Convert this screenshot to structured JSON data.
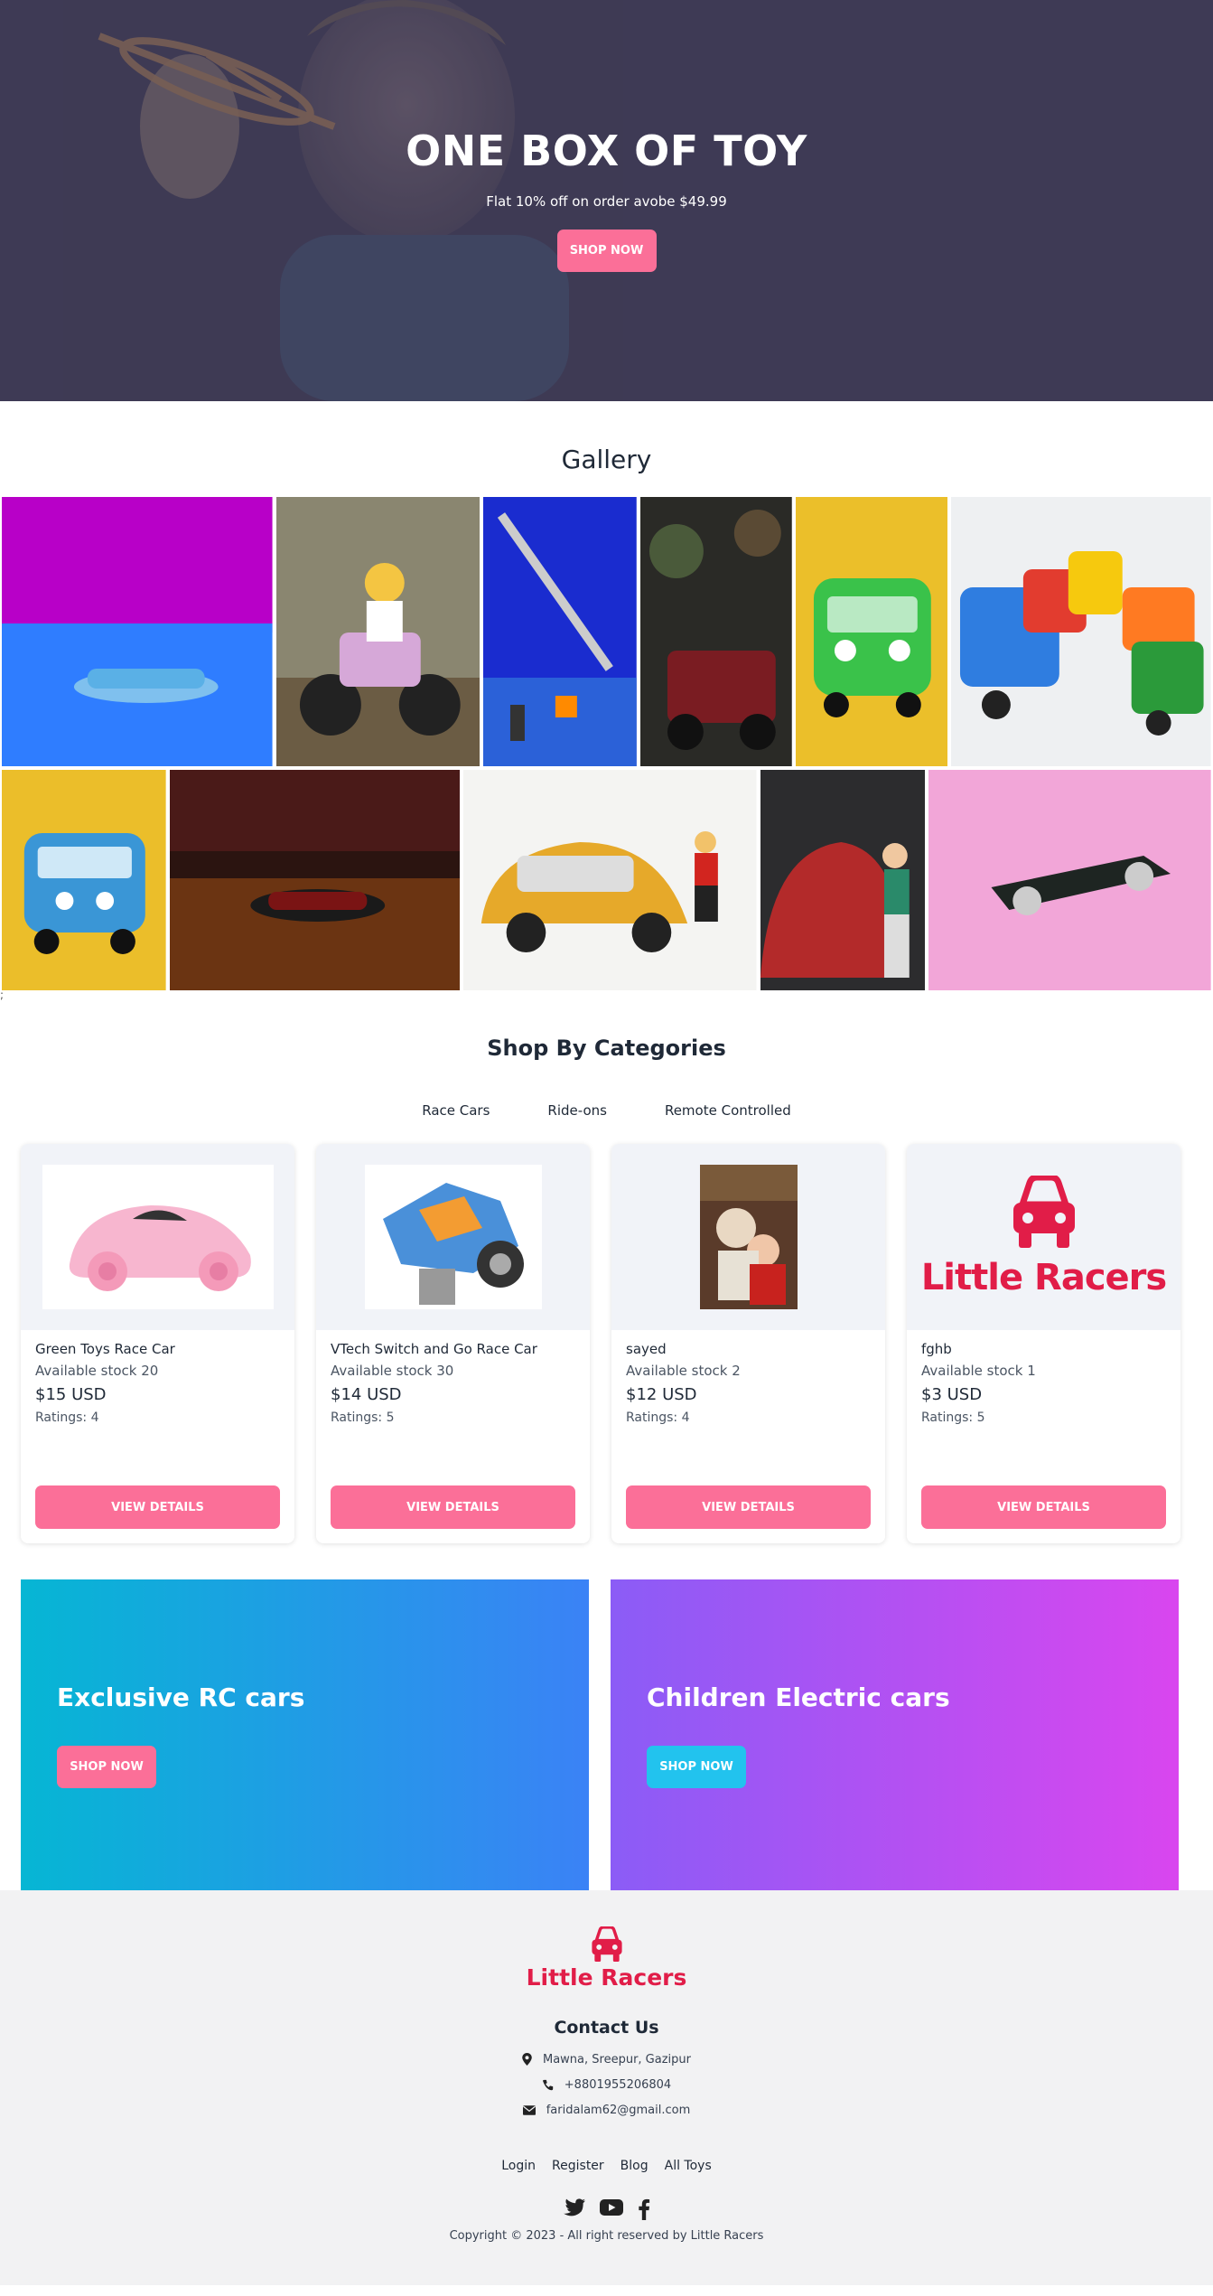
{
  "hero": {
    "title": "ONE BOX OF TOY",
    "subtitle": "Flat 10% off on order avobe $49.99",
    "button": "SHOP NOW"
  },
  "gallery": {
    "title": "Gallery",
    "row1": [
      {
        "label": "blue convertible toy car"
      },
      {
        "label": "lego figure on quad bike"
      },
      {
        "label": "lego crane"
      },
      {
        "label": "red toy truck"
      },
      {
        "label": "green toy bus"
      },
      {
        "label": "toy trucks group"
      }
    ],
    "row2": [
      {
        "label": "blue toy bus"
      },
      {
        "label": "black race car"
      },
      {
        "label": "yellow fiat with lego figure"
      },
      {
        "label": "red beetle with figure"
      },
      {
        "label": "black roadster"
      }
    ],
    "stray": ";"
  },
  "categories": {
    "title": "Shop By Categories",
    "tabs": [
      "Race Cars",
      "Ride-ons",
      "Remote Controlled"
    ],
    "cards": [
      {
        "name": "Green Toys Race Car",
        "stock": "Available stock 20",
        "price": "$15 USD",
        "rating": "Ratings: 4",
        "button": "VIEW DETAILS"
      },
      {
        "name": "VTech Switch and Go Race Car",
        "stock": "Available stock 30",
        "price": "$14 USD",
        "rating": "Ratings: 5",
        "button": "VIEW DETAILS"
      },
      {
        "name": "sayed",
        "stock": "Available stock 2",
        "price": "$12 USD",
        "rating": "Ratings: 4",
        "button": "VIEW DETAILS"
      },
      {
        "name": "fghb",
        "stock": "Available stock 1",
        "price": "$3 USD",
        "rating": "Ratings: 5",
        "button": "VIEW DETAILS",
        "logo_text": "Little Racers"
      }
    ]
  },
  "promos": [
    {
      "title": "Exclusive RC cars",
      "button": "SHOP NOW"
    },
    {
      "title": "Children Electric cars",
      "button": "SHOP NOW"
    }
  ],
  "footer": {
    "brand": "Little Racers",
    "contact_title": "Contact Us",
    "address": "Mawna, Sreepur, Gazipur",
    "phone": "+8801955206804",
    "email": "faridalam62@gmail.com",
    "links": [
      "Login",
      "Register",
      "Blog",
      "All Toys"
    ],
    "copyright": "Copyright © 2023 - All right reserved by Little Racers"
  },
  "colors": {
    "accent_pink": "#fb6f98",
    "brand_red": "#e11d48",
    "hero_bg": "#3e3a55",
    "cyan_button": "#22c3ee"
  },
  "icons": [
    "location-icon",
    "phone-icon",
    "mail-icon",
    "twitter-icon",
    "youtube-icon",
    "facebook-icon",
    "car-icon"
  ]
}
